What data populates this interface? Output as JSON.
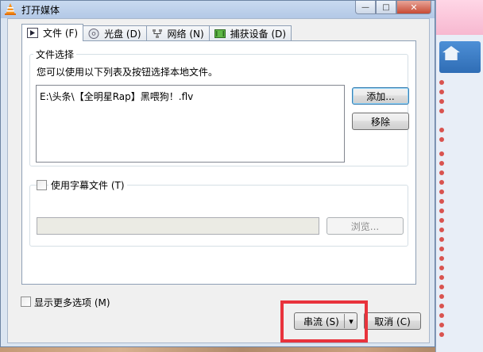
{
  "window": {
    "title": "打开媒体",
    "minimize_glyph": "—",
    "maximize_glyph": "□",
    "close_glyph": "✕"
  },
  "tabs": [
    {
      "label": "文件 (F)",
      "icon": "file-icon",
      "active": true
    },
    {
      "label": "光盘 (D)",
      "icon": "disc-icon",
      "active": false
    },
    {
      "label": "网络 (N)",
      "icon": "network-icon",
      "active": false
    },
    {
      "label": "捕获设备 (D)",
      "icon": "capture-device-icon",
      "active": false
    }
  ],
  "file_selection": {
    "group_title": "文件选择",
    "description": "您可以使用以下列表及按钮选择本地文件。",
    "files": [
      "E:\\头条\\【全明星Rap】黑喂狗！.flv"
    ],
    "add_button": "添加...",
    "remove_button": "移除"
  },
  "subtitle": {
    "checkbox_label": "使用字幕文件 (T)",
    "checked": false,
    "path_value": "",
    "browse_button": "浏览..."
  },
  "more_options": {
    "checkbox_label": "显示更多选项 (M)",
    "checked": false
  },
  "footer": {
    "stream_button": "串流 (S)",
    "dropdown_glyph": "▾",
    "cancel_button": "取消 (C)"
  },
  "colors": {
    "highlight_box": "#e8333c",
    "titlebar": "#b3c8e6",
    "close_button": "#c74a34"
  }
}
